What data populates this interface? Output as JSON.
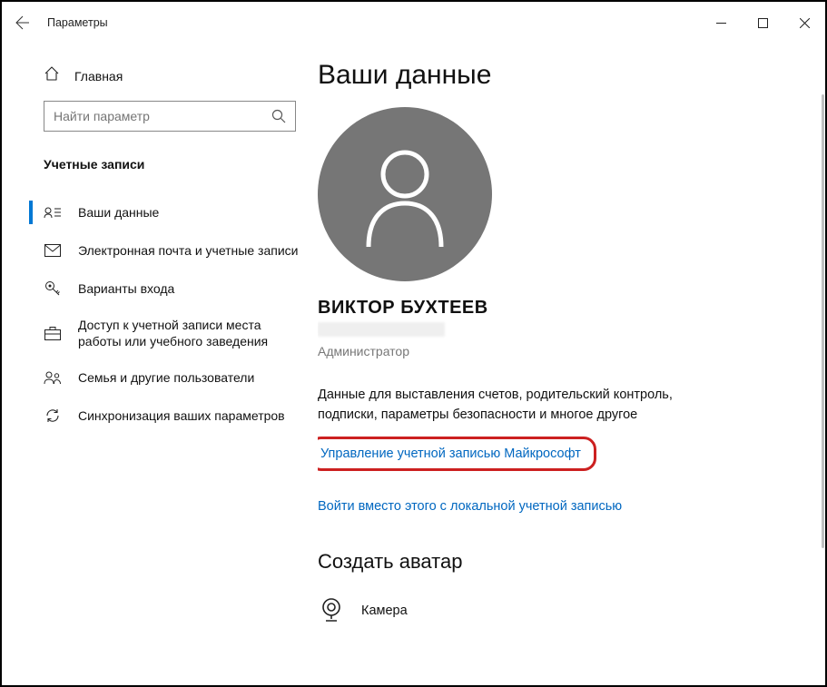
{
  "window": {
    "title": "Параметры"
  },
  "sidebar": {
    "home": "Главная",
    "search_placeholder": "Найти параметр",
    "section_header": "Учетные записи",
    "items": [
      {
        "label": "Ваши данные"
      },
      {
        "label": "Электронная почта и учетные записи"
      },
      {
        "label": "Варианты входа"
      },
      {
        "label": "Доступ к учетной записи места работы или учебного заведения"
      },
      {
        "label": "Семья и другие пользователи"
      },
      {
        "label": "Синхронизация ваших параметров"
      }
    ]
  },
  "main": {
    "page_title": "Ваши данные",
    "user_name": "ВИКТОР БУХТЕЕВ",
    "role": "Администратор",
    "description": "Данные для выставления счетов, родительский контроль, подписки, параметры безопасности и многое другое",
    "ms_link": "Управление учетной записью Майкрософт",
    "local_link": "Войти вместо этого с локальной учетной записью",
    "create_avatar_header": "Создать аватар",
    "camera_label": "Камера"
  }
}
